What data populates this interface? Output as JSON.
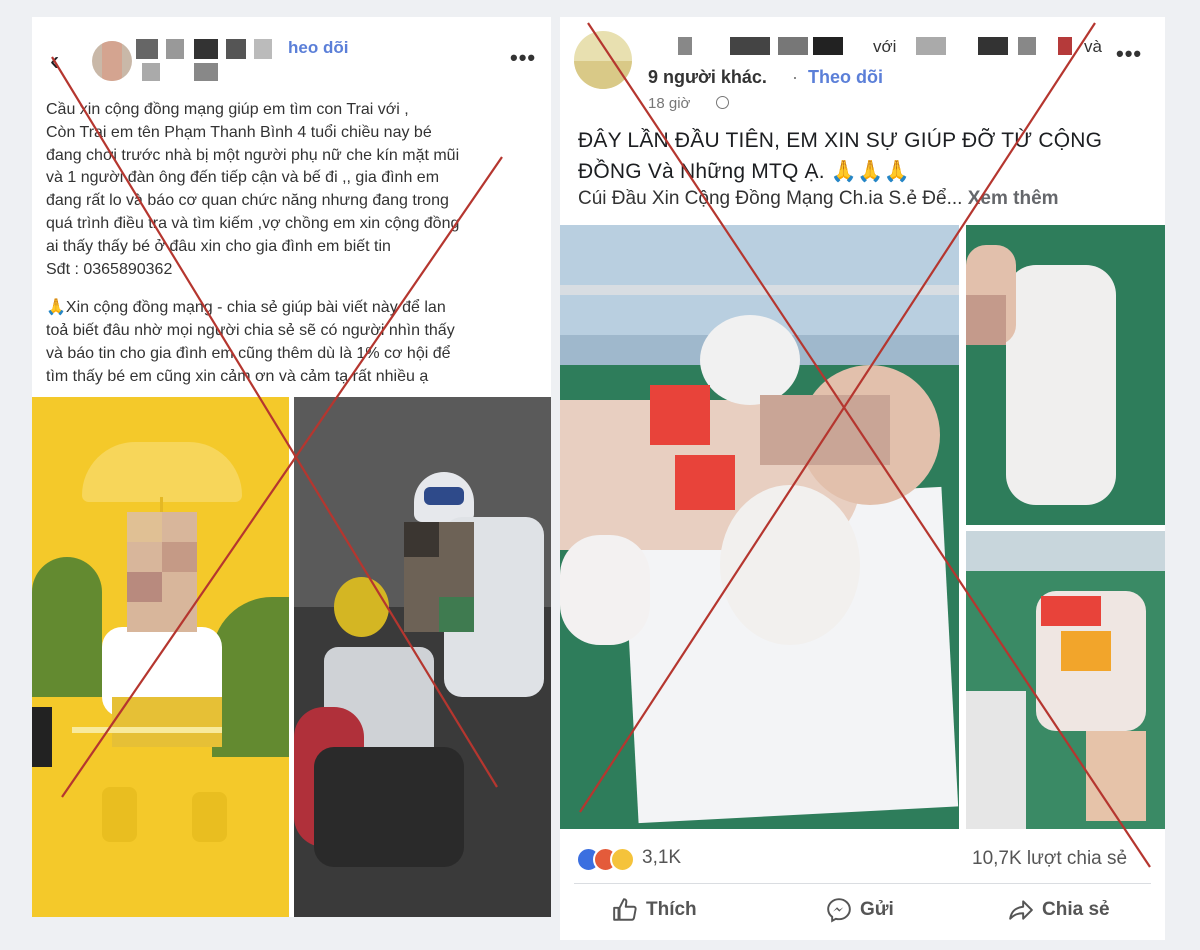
{
  "left_post": {
    "follow_label": "heo dõi",
    "paragraphs": [
      "Cầu xin cộng đồng mạng giúp em tìm con Trai với ,",
      "Còn Trai em tên Phạm Thanh Bình 4 tuổi chiều nay bé",
      "đang chơi trước nhà bị một người phụ nữ che kín mặt mũi",
      "và 1 người đàn ông đến tiếp cận và bế đi ,, gia đình em",
      "đang rất lo và báo cơ quan chức năng nhưng đang trong",
      "quá trình điều tra và tìm kiếm ,vợ chồng em xin cộng đồng",
      "ai thấy thấy bé ở đâu xin cho gia đình em biết tin",
      "Sđt : 0365890362"
    ],
    "paragraphs2": [
      "🙏Xin cộng đồng mạng - chia sẻ giúp bài viết này để lan",
      "toả biết đâu nhờ mọi người chia sẻ sẽ có người nhìn thấy",
      "và báo tin cho gia đình em cũng thêm dù là 1% cơ hội để",
      "tìm thấy bé em cũng xin cảm ơn và cảm tạ rất nhiều ạ"
    ],
    "more_icon": "more-horizontal-icon",
    "back_icon": "chevron-left-icon"
  },
  "right_post": {
    "with_label": "với",
    "and_label": "và",
    "others_label": "9 người khác.",
    "dot": "·",
    "follow_label": "Theo dõi",
    "time_label": "18 giờ",
    "title": "ĐÂY LẦN ĐẦU TIÊN, EM XIN SỰ GIÚP ĐỠ TỪ CỘNG ĐỒNG Và Những MTQ Ạ. 🙏🙏🙏",
    "subtitle": "Cúi Đầu Xin Cộng Đồng Mạng Ch.ia S.ẻ Để...",
    "see_more": "Xem thêm",
    "reaction_count": "3,1K",
    "share_count": "10,7K lượt chia sẻ",
    "actions": {
      "like": "Thích",
      "send": "Gửi",
      "share": "Chia sẻ"
    }
  },
  "colors": {
    "cross": "#b5362f",
    "link": "#5b7fd8",
    "yellow_bg": "#f4c92a",
    "hospital_green": "#2e7d5b"
  }
}
